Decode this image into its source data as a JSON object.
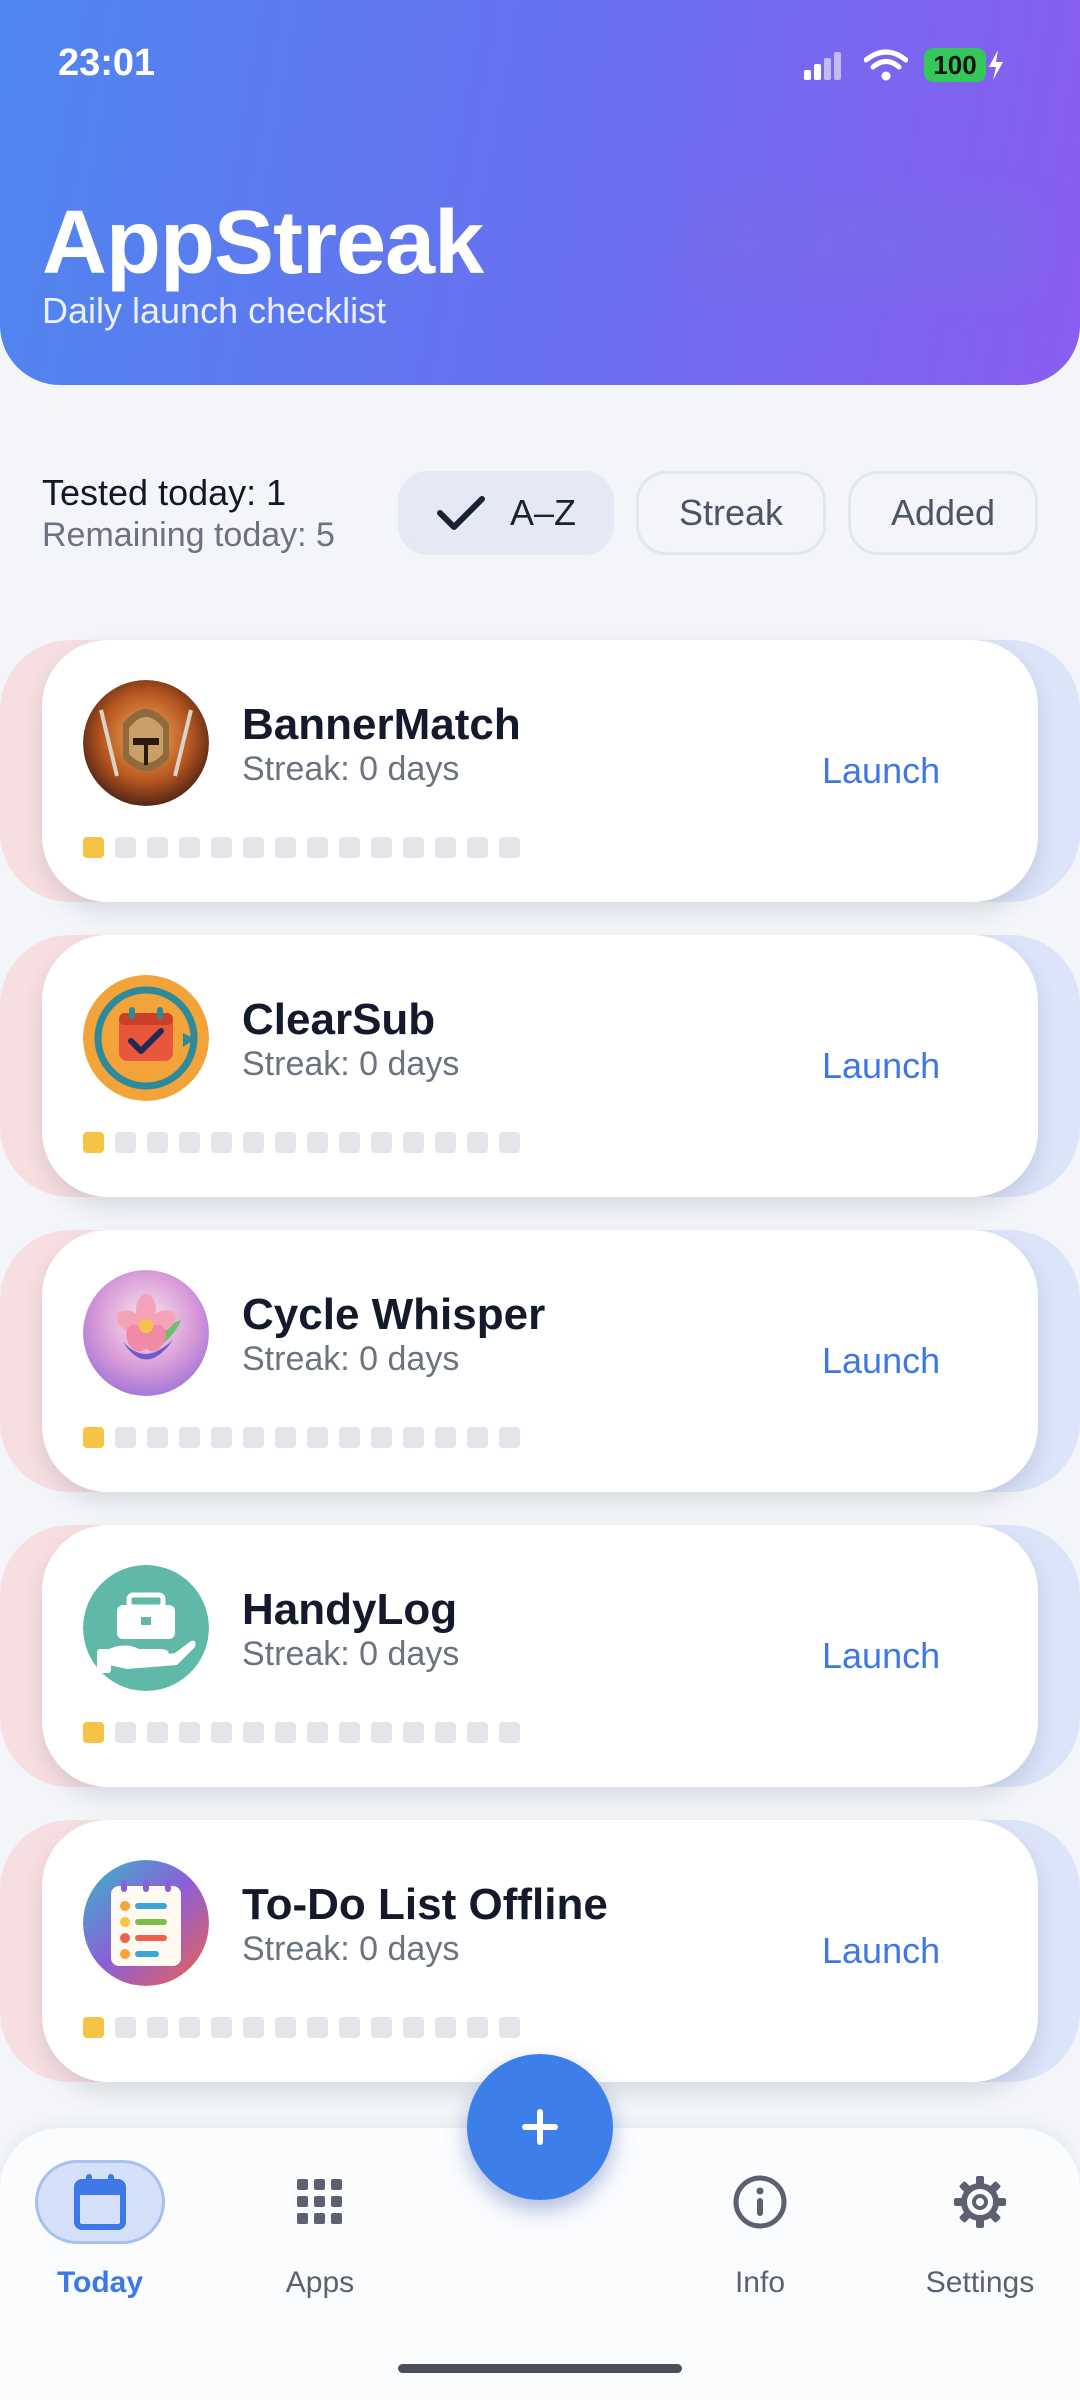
{
  "status_bar": {
    "time": "23:01",
    "battery": "100"
  },
  "header": {
    "title": "AppStreak",
    "subtitle": "Daily launch checklist"
  },
  "summary": {
    "tested_today": "Tested today: 1",
    "remaining_today": "Remaining today: 5"
  },
  "sort_options": [
    {
      "label": "A–Z",
      "selected": true
    },
    {
      "label": "Streak",
      "selected": false
    },
    {
      "label": "Added",
      "selected": false
    }
  ],
  "apps": [
    {
      "name": "BannerMatch",
      "streak": "Streak: 0 days",
      "action": "Launch",
      "icon": "knight-helmet-icon",
      "days_done": 1,
      "days_total": 14
    },
    {
      "name": "ClearSub",
      "streak": "Streak: 0 days",
      "action": "Launch",
      "icon": "calendar-check-icon",
      "days_done": 1,
      "days_total": 14
    },
    {
      "name": "Cycle Whisper",
      "streak": "Streak: 0 days",
      "action": "Launch",
      "icon": "flower-icon",
      "days_done": 1,
      "days_total": 14
    },
    {
      "name": "HandyLog",
      "streak": "Streak: 0 days",
      "action": "Launch",
      "icon": "toolbox-hand-icon",
      "days_done": 1,
      "days_total": 14
    },
    {
      "name": "To-Do List Offline",
      "streak": "Streak: 0 days",
      "action": "Launch",
      "icon": "checklist-icon",
      "days_done": 1,
      "days_total": 14
    }
  ],
  "nav": [
    {
      "label": "Today",
      "icon": "calendar-icon",
      "active": true
    },
    {
      "label": "Apps",
      "icon": "grid-icon",
      "active": false
    },
    {
      "label": "Info",
      "icon": "info-icon",
      "active": false
    },
    {
      "label": "Settings",
      "icon": "gear-icon",
      "active": false
    }
  ],
  "fab": {
    "icon": "plus-icon"
  },
  "colors": {
    "accent": "#3d7ee9",
    "streak_dot_on": "#f6c445",
    "streak_dot_off": "#e3e5ea"
  }
}
